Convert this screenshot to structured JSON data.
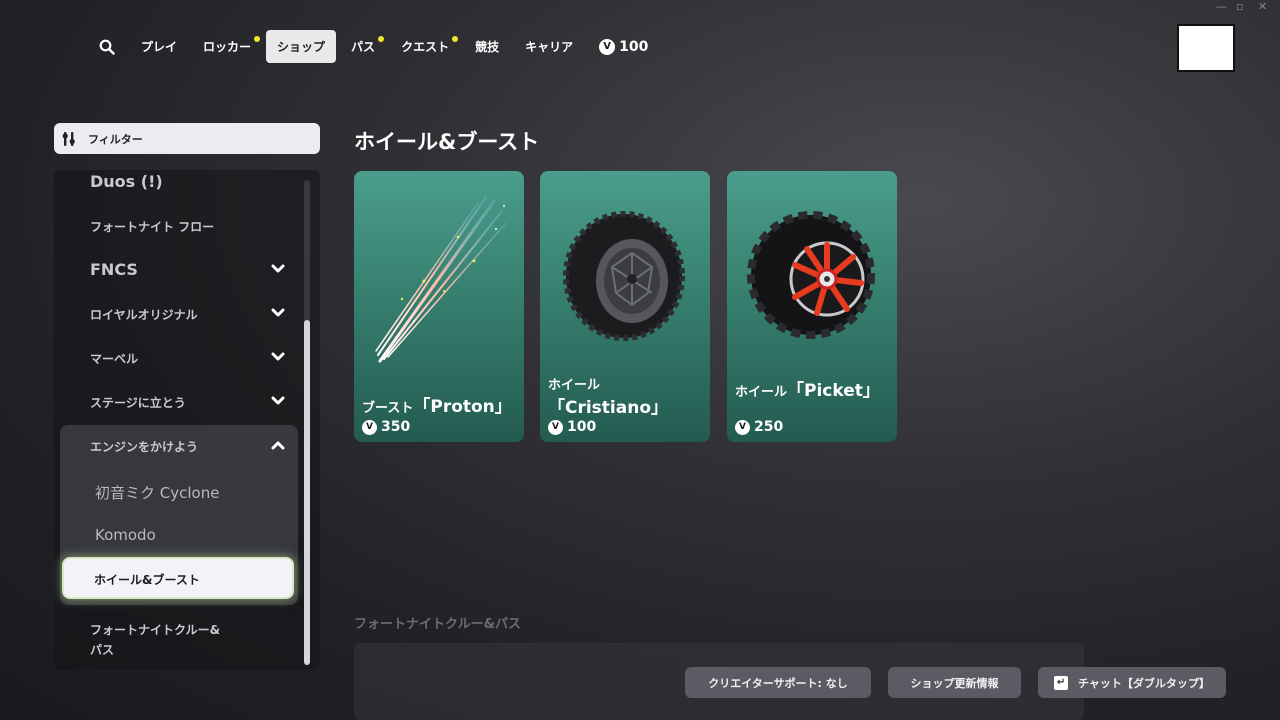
{
  "nav": {
    "items": [
      {
        "label": "プレイ",
        "dot": false,
        "active": false
      },
      {
        "label": "ロッカー",
        "dot": true,
        "active": false
      },
      {
        "label": "ショップ",
        "dot": false,
        "active": true
      },
      {
        "label": "パス",
        "dot": true,
        "active": false
      },
      {
        "label": "クエスト",
        "dot": true,
        "active": false
      },
      {
        "label": "競技",
        "dot": false,
        "active": false
      },
      {
        "label": "キャリア",
        "dot": false,
        "active": false
      }
    ],
    "vbucks": "100",
    "vbucks_symbol": "V"
  },
  "sidebar": {
    "filter_label": "フィルター",
    "items": [
      {
        "label": "Duos (!)"
      },
      {
        "label": "フォートナイト フロー"
      },
      {
        "label": "FNCS"
      },
      {
        "label": "ロイヤルオリジナル"
      },
      {
        "label": "マーベル"
      },
      {
        "label": "ステージに立とう"
      },
      {
        "label": "エンジンをかけよう"
      }
    ],
    "sub_items": [
      {
        "label": "初音ミク Cyclone"
      },
      {
        "label": "Komodo"
      },
      {
        "label": "ホイール&ブースト",
        "selected": true
      }
    ],
    "after": {
      "line1": "フォートナイトクルー&",
      "line2": "パス"
    }
  },
  "main": {
    "section_title": "ホイール&ブースト",
    "cards": [
      {
        "prefix": "ブースト",
        "name": "「Proton」",
        "price": "350",
        "icon": "boost-trail"
      },
      {
        "prefix": "ホイール",
        "name": "「Cristiano」",
        "price": "100",
        "icon": "wheel-black"
      },
      {
        "prefix": "ホイール",
        "name": "「Picket」",
        "price": "250",
        "icon": "wheel-red"
      }
    ],
    "section2_title": "フォートナイトクルー&パス"
  },
  "footer": {
    "creator_support": "クリエイターサポート: なし",
    "shop_update": "ショップ更新情報",
    "chat": "チャット【ダブルタップ】"
  },
  "colors": {
    "card_teal": "#3f8f7e",
    "notification_dot": "#f2e62a",
    "selected_glow": "#d8e8c0"
  }
}
